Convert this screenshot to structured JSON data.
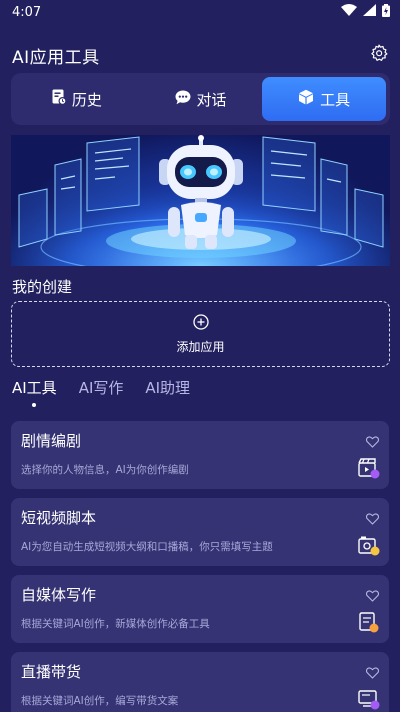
{
  "status_bar": {
    "time": "4:07"
  },
  "header": {
    "title": "AI应用工具"
  },
  "segment_tabs": [
    {
      "label": "历史",
      "icon": "history-doc-icon"
    },
    {
      "label": "对话",
      "icon": "chat-bubble-icon"
    },
    {
      "label": "工具",
      "icon": "cube-icon",
      "active": true
    }
  ],
  "my_creations": {
    "title": "我的创建",
    "add_label": "添加应用"
  },
  "category_tabs": [
    {
      "label": "AI工具",
      "active": true
    },
    {
      "label": "AI写作"
    },
    {
      "label": "AI助理"
    }
  ],
  "cards": [
    {
      "title": "剧情编剧",
      "desc": "选择你的人物信息，AI为你创作编剧",
      "icon": "clapperboard-icon"
    },
    {
      "title": "短视频脚本",
      "desc": "AI为您自动生成短视频大纲和口播稿，你只需填写主题",
      "icon": "video-camera-icon"
    },
    {
      "title": "自媒体写作",
      "desc": "根据关键词AI创作，新媒体创作必备工具",
      "icon": "document-edit-icon"
    },
    {
      "title": "直播带货",
      "desc": "根据关键词AI创作，编写带货文案",
      "icon": "monitor-icon"
    }
  ],
  "colors": {
    "background": "#22205e",
    "card": "#353373",
    "segment_bg": "#2e2c6e",
    "accent_blue": "#3a7bff",
    "badge_yellow": "#f5c542",
    "badge_purple": "#a45cf5"
  }
}
